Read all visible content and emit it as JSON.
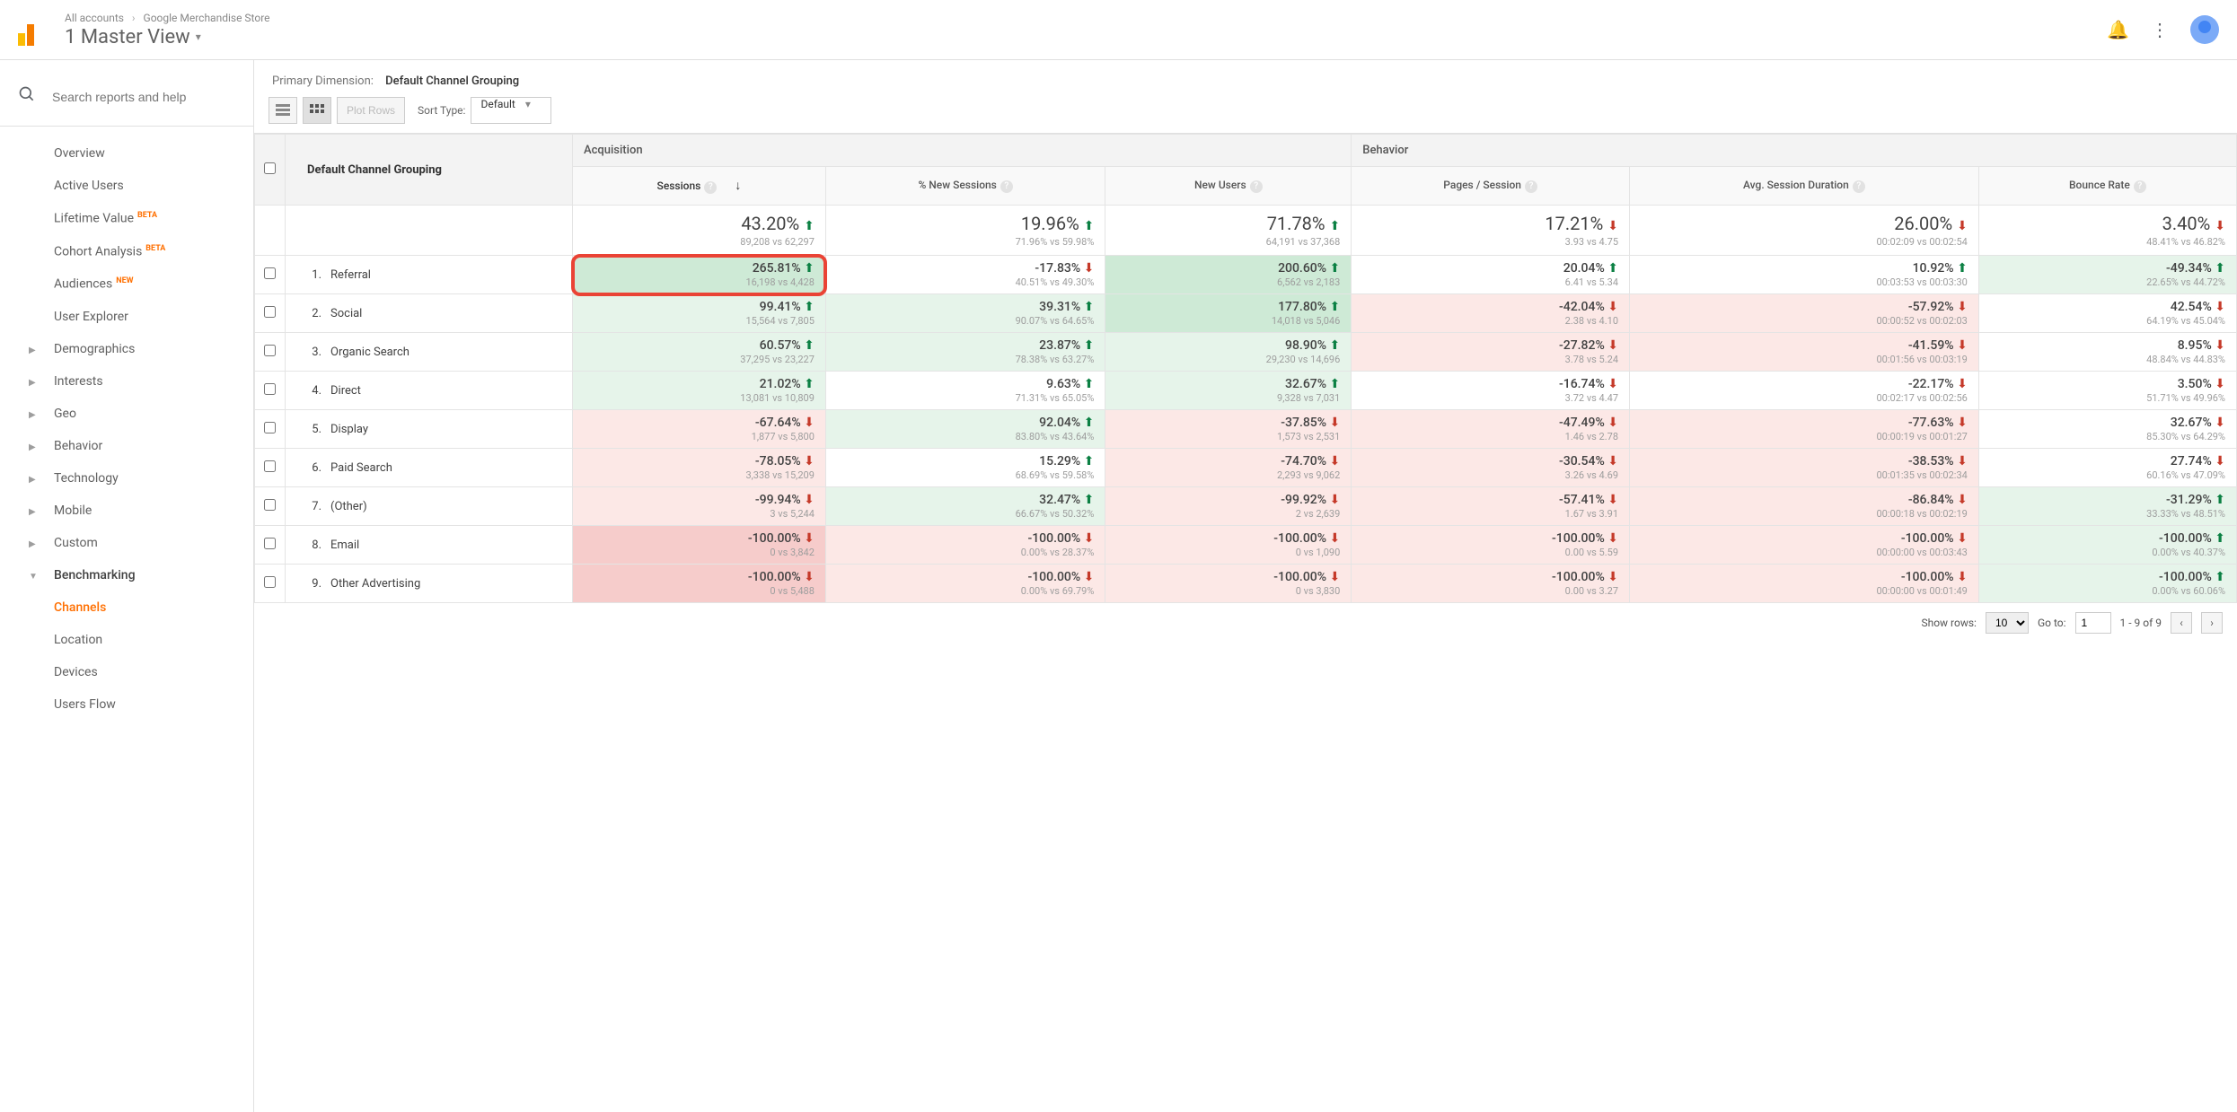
{
  "header": {
    "breadcrumb_accounts": "All accounts",
    "breadcrumb_store": "Google Merchandise Store",
    "view_title": "1 Master View"
  },
  "search": {
    "placeholder": "Search reports and help"
  },
  "sidebar": {
    "items": [
      {
        "label": "Overview",
        "expand": false
      },
      {
        "label": "Active Users",
        "expand": false
      },
      {
        "label": "Lifetime Value",
        "expand": false,
        "badge": "BETA"
      },
      {
        "label": "Cohort Analysis",
        "expand": false,
        "badge": "BETA"
      },
      {
        "label": "Audiences",
        "expand": false,
        "badge": "NEW"
      },
      {
        "label": "User Explorer",
        "expand": false
      },
      {
        "label": "Demographics",
        "expand": true
      },
      {
        "label": "Interests",
        "expand": true
      },
      {
        "label": "Geo",
        "expand": true
      },
      {
        "label": "Behavior",
        "expand": true
      },
      {
        "label": "Technology",
        "expand": true
      },
      {
        "label": "Mobile",
        "expand": true
      },
      {
        "label": "Custom",
        "expand": true
      },
      {
        "label": "Benchmarking",
        "expand": true,
        "open": true
      },
      {
        "label": "Channels",
        "active": true
      },
      {
        "label": "Location"
      },
      {
        "label": "Devices"
      },
      {
        "label": "Users Flow"
      }
    ]
  },
  "dimension": {
    "label": "Primary Dimension:",
    "value": "Default Channel Grouping"
  },
  "toolbar": {
    "plot": "Plot Rows",
    "sort_label": "Sort Type:",
    "sort_value": "Default"
  },
  "columns": {
    "dim": "Default Channel Grouping",
    "groups": {
      "acq": "Acquisition",
      "beh": "Behavior"
    },
    "c1": "Sessions",
    "c2": "% New Sessions",
    "c3": "New Users",
    "c4": "Pages / Session",
    "c5": "Avg. Session Duration",
    "c6": "Bounce Rate"
  },
  "summary": {
    "c1": {
      "pct": "43.20%",
      "dir": "up",
      "sub": "89,208 vs 62,297"
    },
    "c2": {
      "pct": "19.96%",
      "dir": "up",
      "sub": "71.96% vs 59.98%"
    },
    "c3": {
      "pct": "71.78%",
      "dir": "up",
      "sub": "64,191 vs 37,368"
    },
    "c4": {
      "pct": "17.21%",
      "dir": "dn",
      "sub": "3.93 vs 4.75"
    },
    "c5": {
      "pct": "26.00%",
      "dir": "dn",
      "sub": "00:02:09 vs 00:02:54"
    },
    "c6": {
      "pct": "3.40%",
      "dir": "dn",
      "sub": "48.41% vs 46.82%"
    }
  },
  "rows": [
    {
      "n": "1.",
      "name": "Referral",
      "c1": {
        "pct": "265.81%",
        "dir": "up",
        "sub": "16,198 vs 4,428",
        "cls": "goodstrong",
        "hl": true
      },
      "c2": {
        "pct": "-17.83%",
        "dir": "dn",
        "sub": "40.51% vs 49.30%",
        "cls": ""
      },
      "c3": {
        "pct": "200.60%",
        "dir": "up",
        "sub": "6,562 vs 2,183",
        "cls": "goodstrong"
      },
      "c4": {
        "pct": "20.04%",
        "dir": "up",
        "sub": "6.41 vs 5.34",
        "cls": ""
      },
      "c5": {
        "pct": "10.92%",
        "dir": "up",
        "sub": "00:03:53 vs 00:03:30",
        "cls": ""
      },
      "c6": {
        "pct": "-49.34%",
        "dir": "up",
        "sub": "22.65% vs 44.72%",
        "cls": "good"
      }
    },
    {
      "n": "2.",
      "name": "Social",
      "c1": {
        "pct": "99.41%",
        "dir": "up",
        "sub": "15,564 vs 7,805",
        "cls": "good"
      },
      "c2": {
        "pct": "39.31%",
        "dir": "up",
        "sub": "90.07% vs 64.65%",
        "cls": "good"
      },
      "c3": {
        "pct": "177.80%",
        "dir": "up",
        "sub": "14,018 vs 5,046",
        "cls": "goodstrong"
      },
      "c4": {
        "pct": "-42.04%",
        "dir": "dn",
        "sub": "2.38 vs 4.10",
        "cls": "bad"
      },
      "c5": {
        "pct": "-57.92%",
        "dir": "dn",
        "sub": "00:00:52 vs 00:02:03",
        "cls": "bad"
      },
      "c6": {
        "pct": "42.54%",
        "dir": "dn",
        "sub": "64.19% vs 45.04%",
        "cls": ""
      }
    },
    {
      "n": "3.",
      "name": "Organic Search",
      "c1": {
        "pct": "60.57%",
        "dir": "up",
        "sub": "37,295 vs 23,227",
        "cls": "good"
      },
      "c2": {
        "pct": "23.87%",
        "dir": "up",
        "sub": "78.38% vs 63.27%",
        "cls": "good"
      },
      "c3": {
        "pct": "98.90%",
        "dir": "up",
        "sub": "29,230 vs 14,696",
        "cls": "good"
      },
      "c4": {
        "pct": "-27.82%",
        "dir": "dn",
        "sub": "3.78 vs 5.24",
        "cls": "bad"
      },
      "c5": {
        "pct": "-41.59%",
        "dir": "dn",
        "sub": "00:01:56 vs 00:03:19",
        "cls": "bad"
      },
      "c6": {
        "pct": "8.95%",
        "dir": "dn",
        "sub": "48.84% vs 44.83%",
        "cls": ""
      }
    },
    {
      "n": "4.",
      "name": "Direct",
      "c1": {
        "pct": "21.02%",
        "dir": "up",
        "sub": "13,081 vs 10,809",
        "cls": "good"
      },
      "c2": {
        "pct": "9.63%",
        "dir": "up",
        "sub": "71.31% vs 65.05%",
        "cls": ""
      },
      "c3": {
        "pct": "32.67%",
        "dir": "up",
        "sub": "9,328 vs 7,031",
        "cls": "good"
      },
      "c4": {
        "pct": "-16.74%",
        "dir": "dn",
        "sub": "3.72 vs 4.47",
        "cls": ""
      },
      "c5": {
        "pct": "-22.17%",
        "dir": "dn",
        "sub": "00:02:17 vs 00:02:56",
        "cls": ""
      },
      "c6": {
        "pct": "3.50%",
        "dir": "dn",
        "sub": "51.71% vs 49.96%",
        "cls": ""
      }
    },
    {
      "n": "5.",
      "name": "Display",
      "c1": {
        "pct": "-67.64%",
        "dir": "dn",
        "sub": "1,877 vs 5,800",
        "cls": "bad"
      },
      "c2": {
        "pct": "92.04%",
        "dir": "up",
        "sub": "83.80% vs 43.64%",
        "cls": "good"
      },
      "c3": {
        "pct": "-37.85%",
        "dir": "dn",
        "sub": "1,573 vs 2,531",
        "cls": "bad"
      },
      "c4": {
        "pct": "-47.49%",
        "dir": "dn",
        "sub": "1.46 vs 2.78",
        "cls": "bad"
      },
      "c5": {
        "pct": "-77.63%",
        "dir": "dn",
        "sub": "00:00:19 vs 00:01:27",
        "cls": "bad"
      },
      "c6": {
        "pct": "32.67%",
        "dir": "dn",
        "sub": "85.30% vs 64.29%",
        "cls": ""
      }
    },
    {
      "n": "6.",
      "name": "Paid Search",
      "c1": {
        "pct": "-78.05%",
        "dir": "dn",
        "sub": "3,338 vs 15,209",
        "cls": "bad"
      },
      "c2": {
        "pct": "15.29%",
        "dir": "up",
        "sub": "68.69% vs 59.58%",
        "cls": ""
      },
      "c3": {
        "pct": "-74.70%",
        "dir": "dn",
        "sub": "2,293 vs 9,062",
        "cls": "bad"
      },
      "c4": {
        "pct": "-30.54%",
        "dir": "dn",
        "sub": "3.26 vs 4.69",
        "cls": "bad"
      },
      "c5": {
        "pct": "-38.53%",
        "dir": "dn",
        "sub": "00:01:35 vs 00:02:34",
        "cls": "bad"
      },
      "c6": {
        "pct": "27.74%",
        "dir": "dn",
        "sub": "60.16% vs 47.09%",
        "cls": ""
      }
    },
    {
      "n": "7.",
      "name": "(Other)",
      "c1": {
        "pct": "-99.94%",
        "dir": "dn",
        "sub": "3 vs 5,244",
        "cls": "bad"
      },
      "c2": {
        "pct": "32.47%",
        "dir": "up",
        "sub": "66.67% vs 50.32%",
        "cls": "good"
      },
      "c3": {
        "pct": "-99.92%",
        "dir": "dn",
        "sub": "2 vs 2,639",
        "cls": "bad"
      },
      "c4": {
        "pct": "-57.41%",
        "dir": "dn",
        "sub": "1.67 vs 3.91",
        "cls": "bad"
      },
      "c5": {
        "pct": "-86.84%",
        "dir": "dn",
        "sub": "00:00:18 vs 00:02:19",
        "cls": "bad"
      },
      "c6": {
        "pct": "-31.29%",
        "dir": "up",
        "sub": "33.33% vs 48.51%",
        "cls": "good"
      }
    },
    {
      "n": "8.",
      "name": "Email",
      "c1": {
        "pct": "-100.00%",
        "dir": "dn",
        "sub": "0 vs 3,842",
        "cls": "badstrong"
      },
      "c2": {
        "pct": "-100.00%",
        "dir": "dn",
        "sub": "0.00% vs 28.37%",
        "cls": "bad"
      },
      "c3": {
        "pct": "-100.00%",
        "dir": "dn",
        "sub": "0 vs 1,090",
        "cls": "bad"
      },
      "c4": {
        "pct": "-100.00%",
        "dir": "dn",
        "sub": "0.00 vs 5.59",
        "cls": "bad"
      },
      "c5": {
        "pct": "-100.00%",
        "dir": "dn",
        "sub": "00:00:00 vs 00:03:43",
        "cls": "bad"
      },
      "c6": {
        "pct": "-100.00%",
        "dir": "up",
        "sub": "0.00% vs 40.37%",
        "cls": "good"
      }
    },
    {
      "n": "9.",
      "name": "Other Advertising",
      "c1": {
        "pct": "-100.00%",
        "dir": "dn",
        "sub": "0 vs 5,488",
        "cls": "badstrong"
      },
      "c2": {
        "pct": "-100.00%",
        "dir": "dn",
        "sub": "0.00% vs 69.79%",
        "cls": "bad"
      },
      "c3": {
        "pct": "-100.00%",
        "dir": "dn",
        "sub": "0 vs 3,830",
        "cls": "bad"
      },
      "c4": {
        "pct": "-100.00%",
        "dir": "dn",
        "sub": "0.00 vs 3.27",
        "cls": "bad"
      },
      "c5": {
        "pct": "-100.00%",
        "dir": "dn",
        "sub": "00:00:00 vs 00:01:49",
        "cls": "bad"
      },
      "c6": {
        "pct": "-100.00%",
        "dir": "up",
        "sub": "0.00% vs 60.06%",
        "cls": "good"
      }
    }
  ],
  "pager": {
    "show_label": "Show rows:",
    "show_value": "10",
    "goto_label": "Go to:",
    "goto_value": "1",
    "range": "1 - 9 of 9"
  }
}
